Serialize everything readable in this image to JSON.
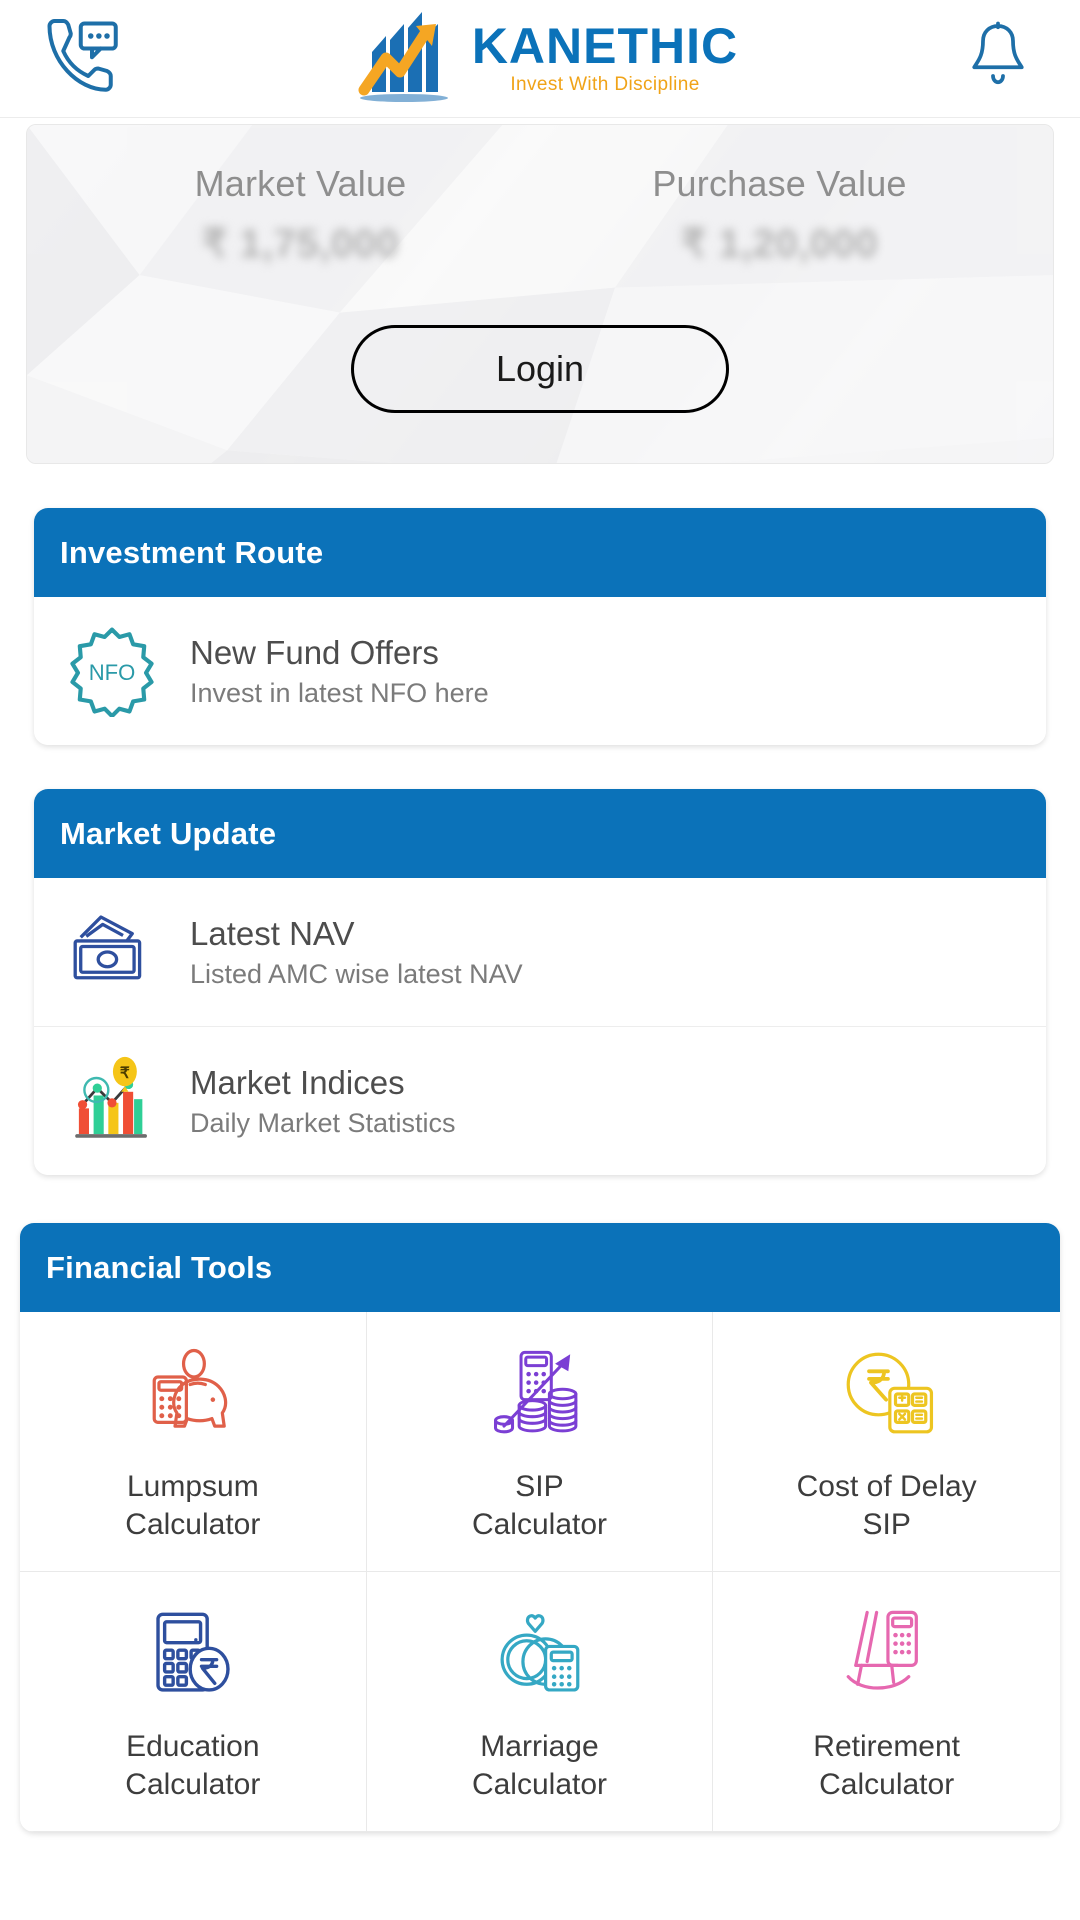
{
  "header": {
    "support_icon": "phone-chat-icon",
    "notification_icon": "bell-icon",
    "brand_ka": "KA",
    "brand_nethic": "NETHIC",
    "brand_full": "KANETHIC",
    "tagline": "Invest With Discipline"
  },
  "portfolio": {
    "market_value_label": "Market Value",
    "market_value": "₹ 1,75,000",
    "purchase_value_label": "Purchase Value",
    "purchase_value": "₹ 1,20,000",
    "login_label": "Login"
  },
  "investment_route": {
    "title": "Investment Route",
    "items": [
      {
        "icon": "nfo-badge-icon",
        "badge_text": "NFO",
        "title": "New Fund Offers",
        "subtitle": "Invest in latest NFO here"
      }
    ]
  },
  "market_update": {
    "title": "Market Update",
    "items": [
      {
        "icon": "banknotes-icon",
        "title": "Latest NAV",
        "subtitle": "Listed AMC wise latest NAV"
      },
      {
        "icon": "market-chart-rupee-icon",
        "title": "Market Indices",
        "subtitle": "Daily Market Statistics"
      }
    ]
  },
  "financial_tools": {
    "title": "Financial Tools",
    "tools": [
      {
        "icon": "piggy-calculator-icon",
        "label": "Lumpsum\nCalculator",
        "color": "#e06049"
      },
      {
        "icon": "calculator-coins-icon",
        "label": "SIP\nCalculator",
        "color": "#7b3fd4"
      },
      {
        "icon": "rupee-coin-calculator-icon",
        "label": "Cost of Delay\nSIP",
        "color": "#edc521"
      },
      {
        "icon": "calculator-rupee-icon",
        "label": "Education\nCalculator",
        "color": "#2e4f9e"
      },
      {
        "icon": "wedding-rings-calculator-icon",
        "label": "Marriage\nCalculator",
        "color": "#35a8c4"
      },
      {
        "icon": "rocking-chair-icon",
        "label": "Retirement\nCalculator",
        "color": "#e668b0"
      }
    ]
  },
  "colors": {
    "brand_blue": "#0b72b9",
    "brand_orange": "#f0a318",
    "section_header_bg": "#0b72b9"
  }
}
